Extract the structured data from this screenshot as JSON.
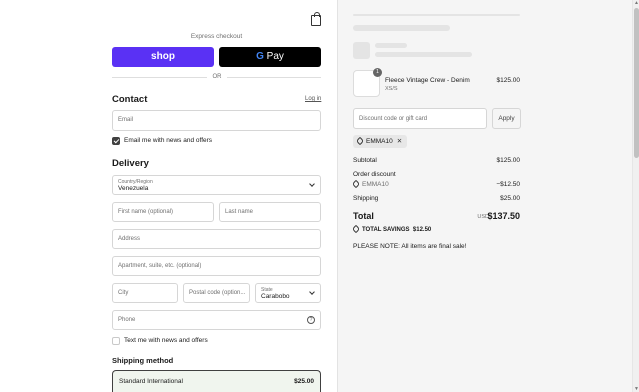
{
  "header": {
    "bag_icon": "shopping-bag-icon"
  },
  "express": {
    "label": "Express checkout",
    "shop_label": "shop",
    "gpay_g": "G",
    "gpay_label": "Pay",
    "or_label": "OR"
  },
  "contact": {
    "heading": "Contact",
    "login_link": "Log in",
    "email_placeholder": "Email",
    "news_label": "Email me with news and offers",
    "news_checked": true
  },
  "delivery": {
    "heading": "Delivery",
    "country_label": "Country/Region",
    "country_value": "Venezuela",
    "first_name_placeholder": "First name (optional)",
    "last_name_placeholder": "Last name",
    "address_placeholder": "Address",
    "apartment_placeholder": "Apartment, suite, etc. (optional)",
    "city_placeholder": "City",
    "postal_placeholder": "Postal code (option...",
    "state_label": "State",
    "state_value": "Carabobo",
    "phone_placeholder": "Phone",
    "help_glyph": "?",
    "text_label": "Text me with news and offers",
    "text_checked": false
  },
  "shipping": {
    "heading": "Shipping method",
    "option_name": "Standard International",
    "option_price": "$25.00"
  },
  "summary": {
    "item": {
      "quantity": "1",
      "name": "Fleece Vintage Crew - Denim",
      "variant": "XS/S",
      "price": "$125.00"
    },
    "discount_placeholder": "Discount code or gift card",
    "apply_label": "Apply",
    "applied_code": "EMMA10",
    "remove_glyph": "✕",
    "subtotal_label": "Subtotal",
    "subtotal_value": "$125.00",
    "order_discount_label": "Order discount",
    "discount_code": "EMMA10",
    "discount_value": "−$12.50",
    "shipping_label": "Shipping",
    "shipping_value": "$25.00",
    "total_label": "Total",
    "currency": "USD",
    "total_value": "$137.50",
    "savings_label": "TOTAL SAVINGS",
    "savings_value": "$12.50",
    "note": "PLEASE NOTE: All items are final sale!"
  },
  "colors": {
    "shop_purple": "#5a31f4",
    "gpay_black": "#000000",
    "selected_bg": "#f0f5ee"
  }
}
